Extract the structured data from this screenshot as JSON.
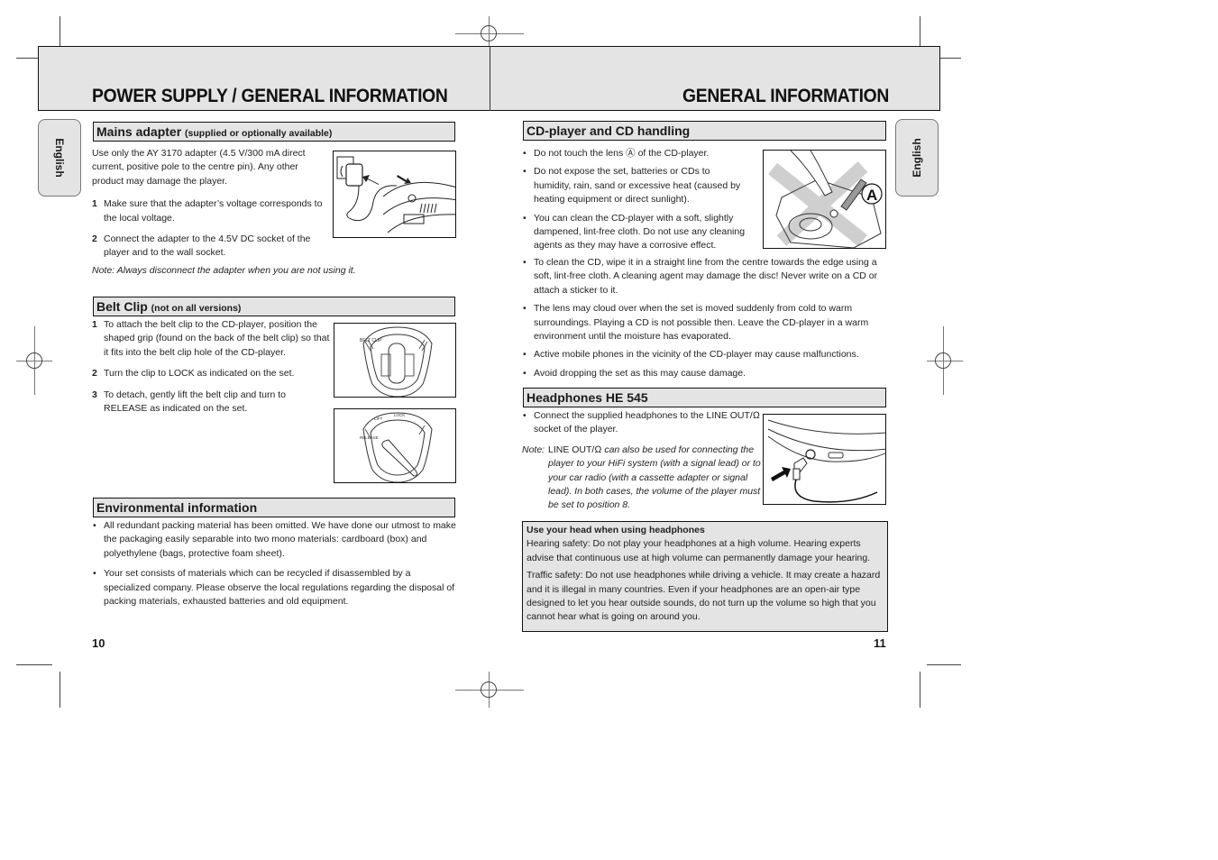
{
  "left_page": {
    "title": "POWER SUPPLY / GENERAL INFORMATION",
    "language_tab": "English",
    "page_number": "10",
    "mains_adapter": {
      "heading": "Mains adapter",
      "heading_note": "(supplied or optionally available)",
      "intro": "Use only the AY 3170 adapter (4.5 V/300 mA direct current, positive pole to the centre pin). Any other product may damage the player.",
      "steps": [
        {
          "num": "1",
          "text": "Make sure that the adapter’s voltage corresponds to the local voltage."
        },
        {
          "num": "2",
          "text": "Connect the adapter to the 4.5V DC socket of the player and to the wall socket."
        }
      ],
      "note": "Note: Always disconnect the adapter when you are not using it.",
      "figure_alt": "adapter-plug-illustration"
    },
    "belt_clip": {
      "heading": "Belt Clip",
      "heading_note": "(not on all versions)",
      "steps": [
        {
          "num": "1",
          "text": "To attach the belt clip to the CD-player, position the shaped grip (found on the back of the belt clip) so that it fits into the belt clip hole of the CD-player."
        },
        {
          "num": "2",
          "text": "Turn the clip to LOCK as indicated on the set."
        },
        {
          "num": "3",
          "text": "To detach, gently lift the belt clip and turn to RELEASE as indicated on the set."
        }
      ],
      "figure1_label": "BELT CLIP",
      "figure2_labels": [
        "LIFT",
        "LOCK",
        "RELEASE"
      ]
    },
    "environmental": {
      "heading": "Environmental information",
      "bullets": [
        "All redundant packing material has been omitted. We have done our utmost to make the packaging easily separable into two mono materials: cardboard (box) and polyethylene (bags, protective foam sheet).",
        "Your set consists of materials which can be recycled if disassembled by a specialized company. Please observe the local regulations regarding the disposal of packing materials, exhausted batteries and old equipment."
      ]
    }
  },
  "right_page": {
    "title": "GENERAL INFORMATION",
    "language_tab": "English",
    "page_number": "11",
    "cd_handling": {
      "heading": "CD-player and CD handling",
      "bullets": [
        "Do not touch the lens Ⓐ of the CD-player.",
        "Do not expose the set, batteries or CDs to humidity, rain, sand or excessive heat (caused by heating equipment or direct sunlight).",
        "You can clean the CD-player with a soft, slightly dampened, lint-free cloth. Do not use any cleaning agents as they may have a corrosive effect.",
        "To clean the CD, wipe it in a straight line from the centre towards the edge using a soft, lint-free cloth. A cleaning agent may damage the disc! Never write on a CD or attach a sticker to it.",
        "The lens may cloud over when the set is moved suddenly from cold to warm surroundings. Playing a CD is not possible then. Leave the CD-player in a warm environment until the moisture has evaporated.",
        "Active mobile phones in the vicinity of the CD-player may cause malfunctions.",
        "Avoid dropping the set as this may cause damage."
      ],
      "figure_label": "A"
    },
    "headphones": {
      "heading": "Headphones HE 545",
      "bullet": "Connect the supplied headphones to the LINE OUT/Ω socket of the player.",
      "note_prefix": "Note:",
      "note_plain": "LINE OUT/Ω",
      "note_text": "can also be used for connecting the player to your HiFi system (with a signal lead) or to your car radio (with a cassette adapter or signal lead). In both cases, the volume of the player must be set to position 8."
    },
    "safety_box": {
      "heading": "Use your head when using headphones",
      "hearing": "Hearing safety: Do not play your headphones at a high volume. Hearing experts advise that continuous use at high volume can permanently damage your hearing.",
      "traffic": "Traffic safety: Do not use headphones while driving a vehicle. It may create a hazard and it is illegal in many countries. Even if your headphones are an open-air type designed to let you hear outside sounds, do not turn up the volume so high that you cannot hear what is going on around you."
    }
  }
}
